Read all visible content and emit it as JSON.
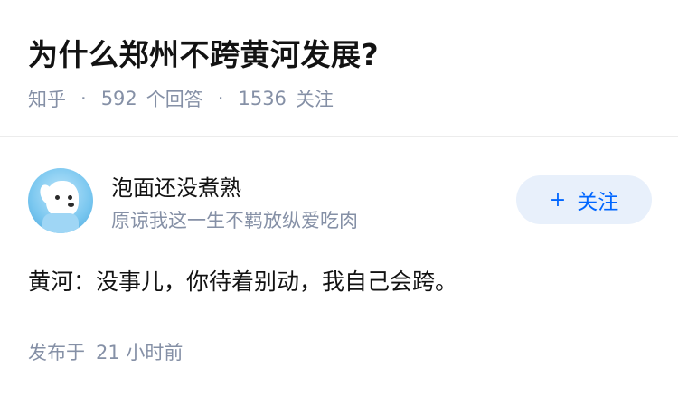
{
  "question": {
    "title": "为什么郑州不跨黄河发展?",
    "source": "知乎",
    "separator": "·",
    "answer_count": "592",
    "answer_label": "个回答",
    "follower_count": "1536",
    "follower_label": "关注"
  },
  "author": {
    "name": "泡面还没煮熟",
    "bio": "原谅我这一生不羁放纵爱吃肉",
    "follow_plus": "+",
    "follow_label": "关注"
  },
  "answer": {
    "content": "黄河：没事儿，你待着别动，我自己会跨。",
    "posted_label": "发布于",
    "posted_time": "21 小时前"
  },
  "colors": {
    "accent": "#0066ff",
    "follow_bg": "#e8f0fb",
    "meta_text": "#8590a6",
    "main_text": "#121212"
  },
  "icons": {
    "avatar": "white-dog-avatar"
  }
}
